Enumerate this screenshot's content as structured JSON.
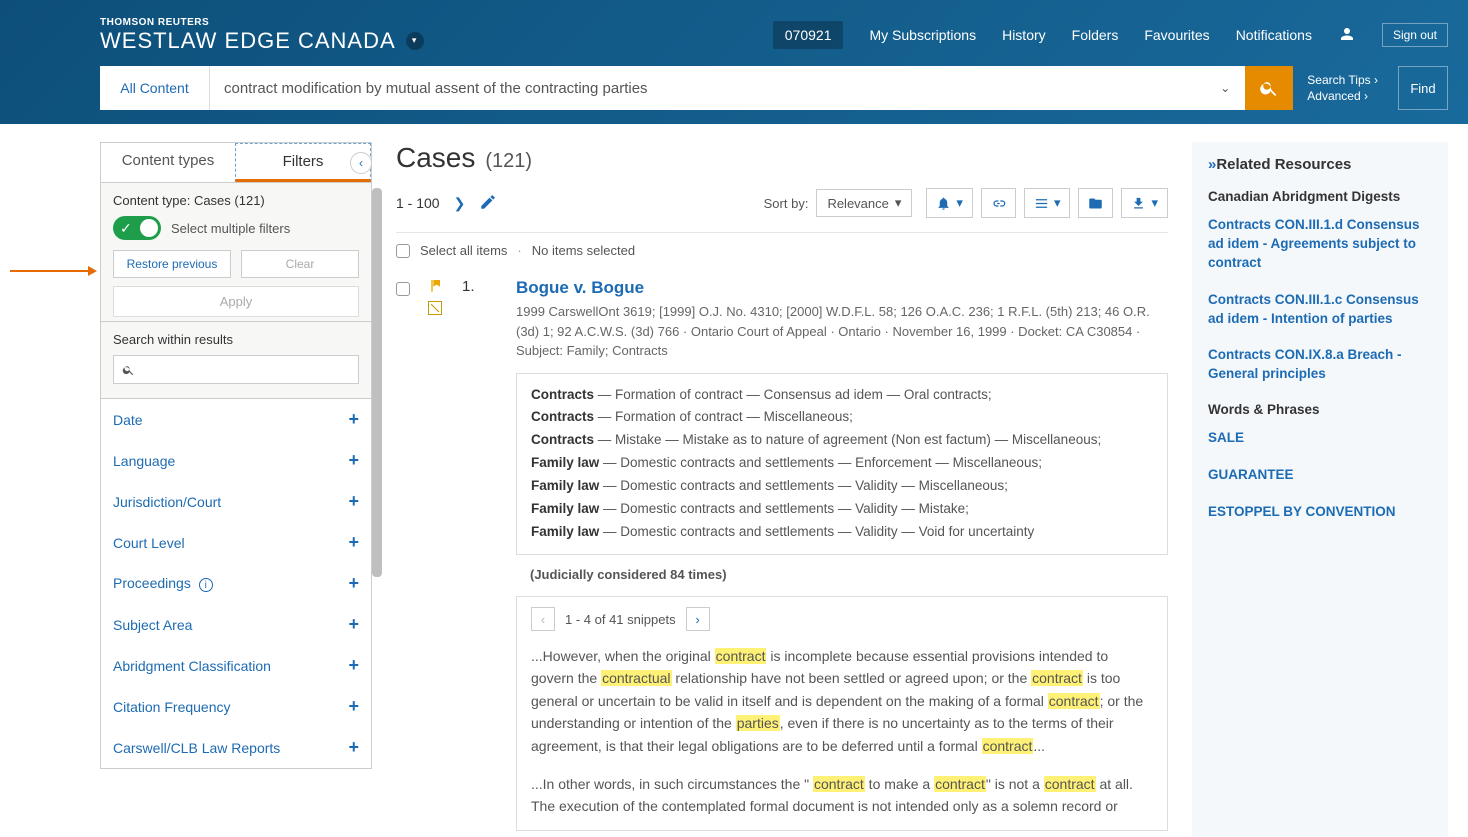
{
  "brand": {
    "company": "THOMSON REUTERS",
    "product": "WESTLAW EDGE CANADA"
  },
  "topnav": {
    "badge": "070921",
    "items": [
      "My Subscriptions",
      "History",
      "Folders",
      "Favourites",
      "Notifications"
    ],
    "signout": "Sign out"
  },
  "search": {
    "scope": "All Content",
    "query": "contract modification by mutual assent of the contracting parties",
    "tips": "Search Tips",
    "advanced": "Advanced",
    "find": "Find"
  },
  "sidebar": {
    "tabs": {
      "content_types": "Content types",
      "filters": "Filters"
    },
    "content_label": "Content type: Cases (121)",
    "multi_label": "Select multiple filters",
    "restore": "Restore previous",
    "clear": "Clear",
    "apply": "Apply",
    "search_within_label": "Search within results",
    "filters": [
      "Date",
      "Language",
      "Jurisdiction/Court",
      "Court Level",
      "Proceedings",
      "Subject Area",
      "Abridgment Classification",
      "Citation Frequency",
      "Carswell/CLB Law Reports"
    ]
  },
  "main": {
    "title": "Cases",
    "count": "(121)",
    "range": "1 - 100",
    "sort_label": "Sort by:",
    "sort_value": "Relevance",
    "select_all": "Select all items",
    "no_selected": "No items selected"
  },
  "result": {
    "number": "1.",
    "title": "Bogue v. Bogue",
    "cite": "1999 CarswellOnt 3619; [1999] O.J. No. 4310; [2000] W.D.F.L. 58; 126 O.A.C. 236; 1 R.F.L. (5th) 213; 46 O.R. (3d) 1; 92 A.C.W.S. (3d) 766  ·  Ontario Court of Appeal  ·  Ontario  ·  November 16, 1999  ·  Docket: CA C30854  ·  Subject: Family; Contracts",
    "topics": [
      {
        "h": "Contracts",
        "t": " — Formation of contract — Consensus ad idem — Oral contracts;"
      },
      {
        "h": "Contracts",
        "t": " — Formation of contract — Miscellaneous;"
      },
      {
        "h": "Contracts",
        "t": " — Mistake — Mistake as to nature of agreement (Non est factum) — Miscellaneous;"
      },
      {
        "h": "Family law",
        "t": " — Domestic contracts and settlements — Enforcement — Miscellaneous;"
      },
      {
        "h": "Family law",
        "t": " — Domestic contracts and settlements — Validity — Miscellaneous;"
      },
      {
        "h": "Family law",
        "t": " — Domestic contracts and settlements — Validity — Mistake;"
      },
      {
        "h": "Family law",
        "t": " — Domestic contracts and settlements — Validity — Void for uncertainty"
      }
    ],
    "jc": "(Judicially considered 84 times)",
    "snip_range": "1 - 4 of 41 snippets",
    "snip1": {
      "p0": "...However, when the original ",
      "h0": "contract",
      "p1": " is incomplete because essential provisions intended to govern the ",
      "h1": "contractual",
      "p2": " relationship have not been settled or agreed upon; or the ",
      "h2": "contract",
      "p3": " is too general or uncertain to be valid in itself and is dependent on the making of a formal ",
      "h3": "contract",
      "p4": "; or the understanding or intention of the ",
      "h4": "parties",
      "p5": ", even if there is no uncertainty as to the terms of their agreement, is that their legal obligations are to be deferred until a formal ",
      "h5": "contract",
      "p6": "..."
    },
    "snip2": {
      "p0": "...In other words, in such circumstances the \" ",
      "h0": "contract",
      "p1": " to make a ",
      "h1": "contract",
      "p2": "\" is not a ",
      "h2": "contract",
      "p3": " at all. The execution of the contemplated formal document is not intended only as a solemn record or"
    }
  },
  "related": {
    "title": "Related Resources",
    "sec1": "Canadian Abridgment Digests",
    "links1": [
      "Contracts CON.III.1.d Consensus ad idem - Agreements subject to contract",
      "Contracts CON.III.1.c Consensus ad idem - Intention of parties",
      "Contracts CON.IX.8.a Breach - General principles"
    ],
    "sec2": "Words & Phrases",
    "links2": [
      "SALE",
      "GUARANTEE",
      "ESTOPPEL BY CONVENTION"
    ]
  }
}
